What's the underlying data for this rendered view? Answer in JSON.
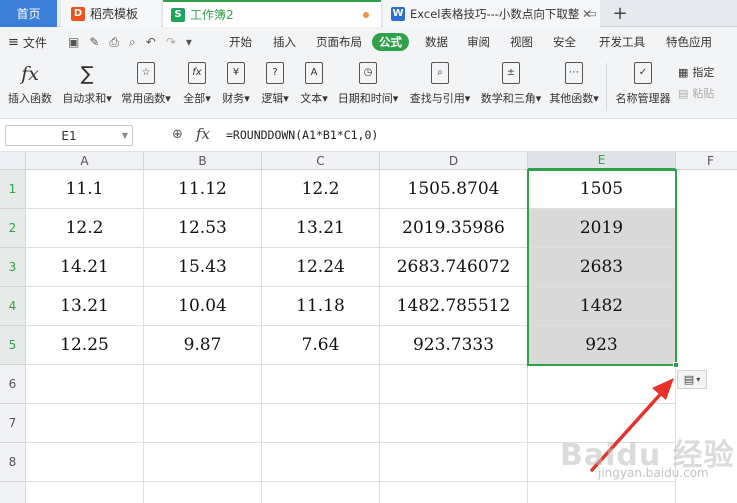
{
  "tabs": {
    "home": "首页",
    "draft": "稻壳模板",
    "workbook": "工作簿2",
    "excel": "Excel表格技巧---小数点向下取整",
    "new_tab": "+"
  },
  "menu": {
    "file": "文件",
    "items": [
      "开始",
      "插入",
      "页面布局",
      "公式",
      "数据",
      "审阅",
      "视图",
      "安全",
      "开发工具",
      "特色应用"
    ],
    "active": "公式"
  },
  "ribbon": {
    "insert_function": "插入函数",
    "autosum": "自动求和",
    "common": "常用函数",
    "all": "全部",
    "finance": "财务",
    "logic": "逻辑",
    "text": "文本",
    "datetime": "日期和时间",
    "lookup": "查找与引用",
    "math": "数学和三角",
    "other": "其他函数",
    "name_manager": "名称管理器",
    "specify": "指定",
    "paste": "粘贴"
  },
  "formula_bar": {
    "name_box": "E1",
    "fx": "fx",
    "formula": "=ROUNDDOWN(A1*B1*C1,0)"
  },
  "columns": [
    "A",
    "B",
    "C",
    "D",
    "E",
    "F"
  ],
  "rows": [
    "1",
    "2",
    "3",
    "4",
    "5",
    "6",
    "7",
    "8"
  ],
  "cells": [
    [
      "11.1",
      "11.12",
      "12.2",
      "1505.8704",
      "1505"
    ],
    [
      "12.2",
      "12.53",
      "13.21",
      "2019.35986",
      "2019"
    ],
    [
      "14.21",
      "15.43",
      "12.24",
      "2683.746072",
      "2683"
    ],
    [
      "13.21",
      "10.04",
      "11.18",
      "1482.785512",
      "1482"
    ],
    [
      "12.25",
      "9.87",
      "7.64",
      "923.7333",
      "923"
    ]
  ],
  "selected_column": "E",
  "watermark": "Baidu 经验",
  "watermark_url": "jingyan.baidu.com",
  "accent": "#2fa14a"
}
